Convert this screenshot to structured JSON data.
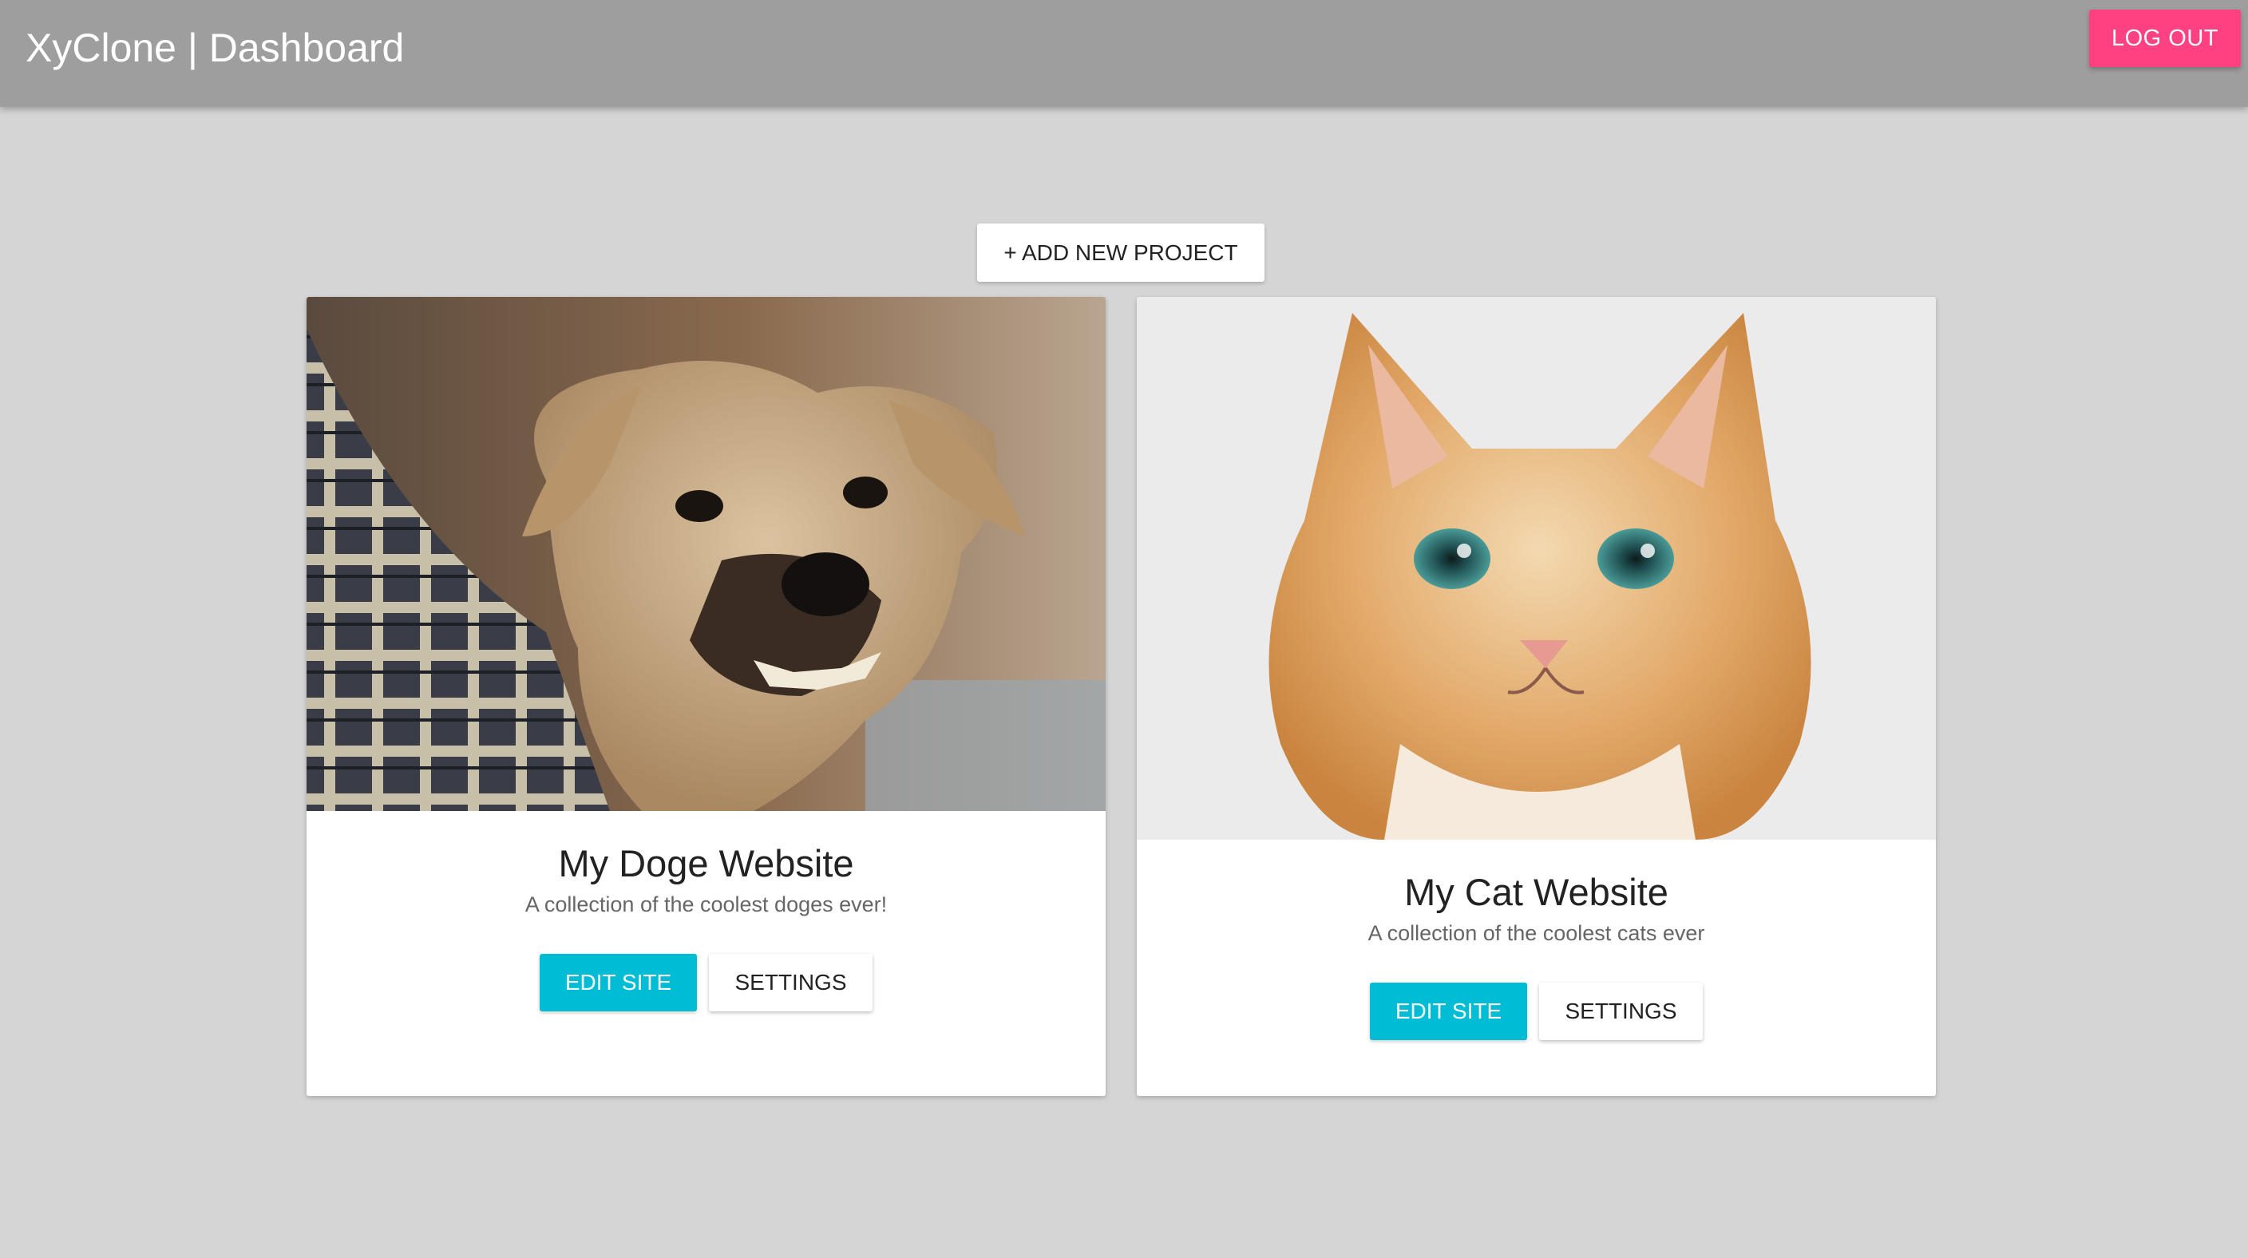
{
  "header": {
    "title": "XyClone | Dashboard",
    "logout_label": "LOG OUT",
    "colors": {
      "bar": "#9e9e9e",
      "logout": "#ff4081"
    }
  },
  "main": {
    "add_project_label": "+ ADD NEW PROJECT",
    "projects": [
      {
        "title": "My Doge Website",
        "description": "A collection of the coolest doges ever!",
        "image": "angry-chihuahua-photo",
        "edit_label": "EDIT SITE",
        "settings_label": "SETTINGS"
      },
      {
        "title": "My Cat Website",
        "description": "A collection of the coolest cats ever",
        "image": "orange-kitten-photo",
        "edit_label": "EDIT SITE",
        "settings_label": "SETTINGS"
      }
    ],
    "colors": {
      "edit": "#00bcd4",
      "background": "#d5d5d5"
    }
  }
}
